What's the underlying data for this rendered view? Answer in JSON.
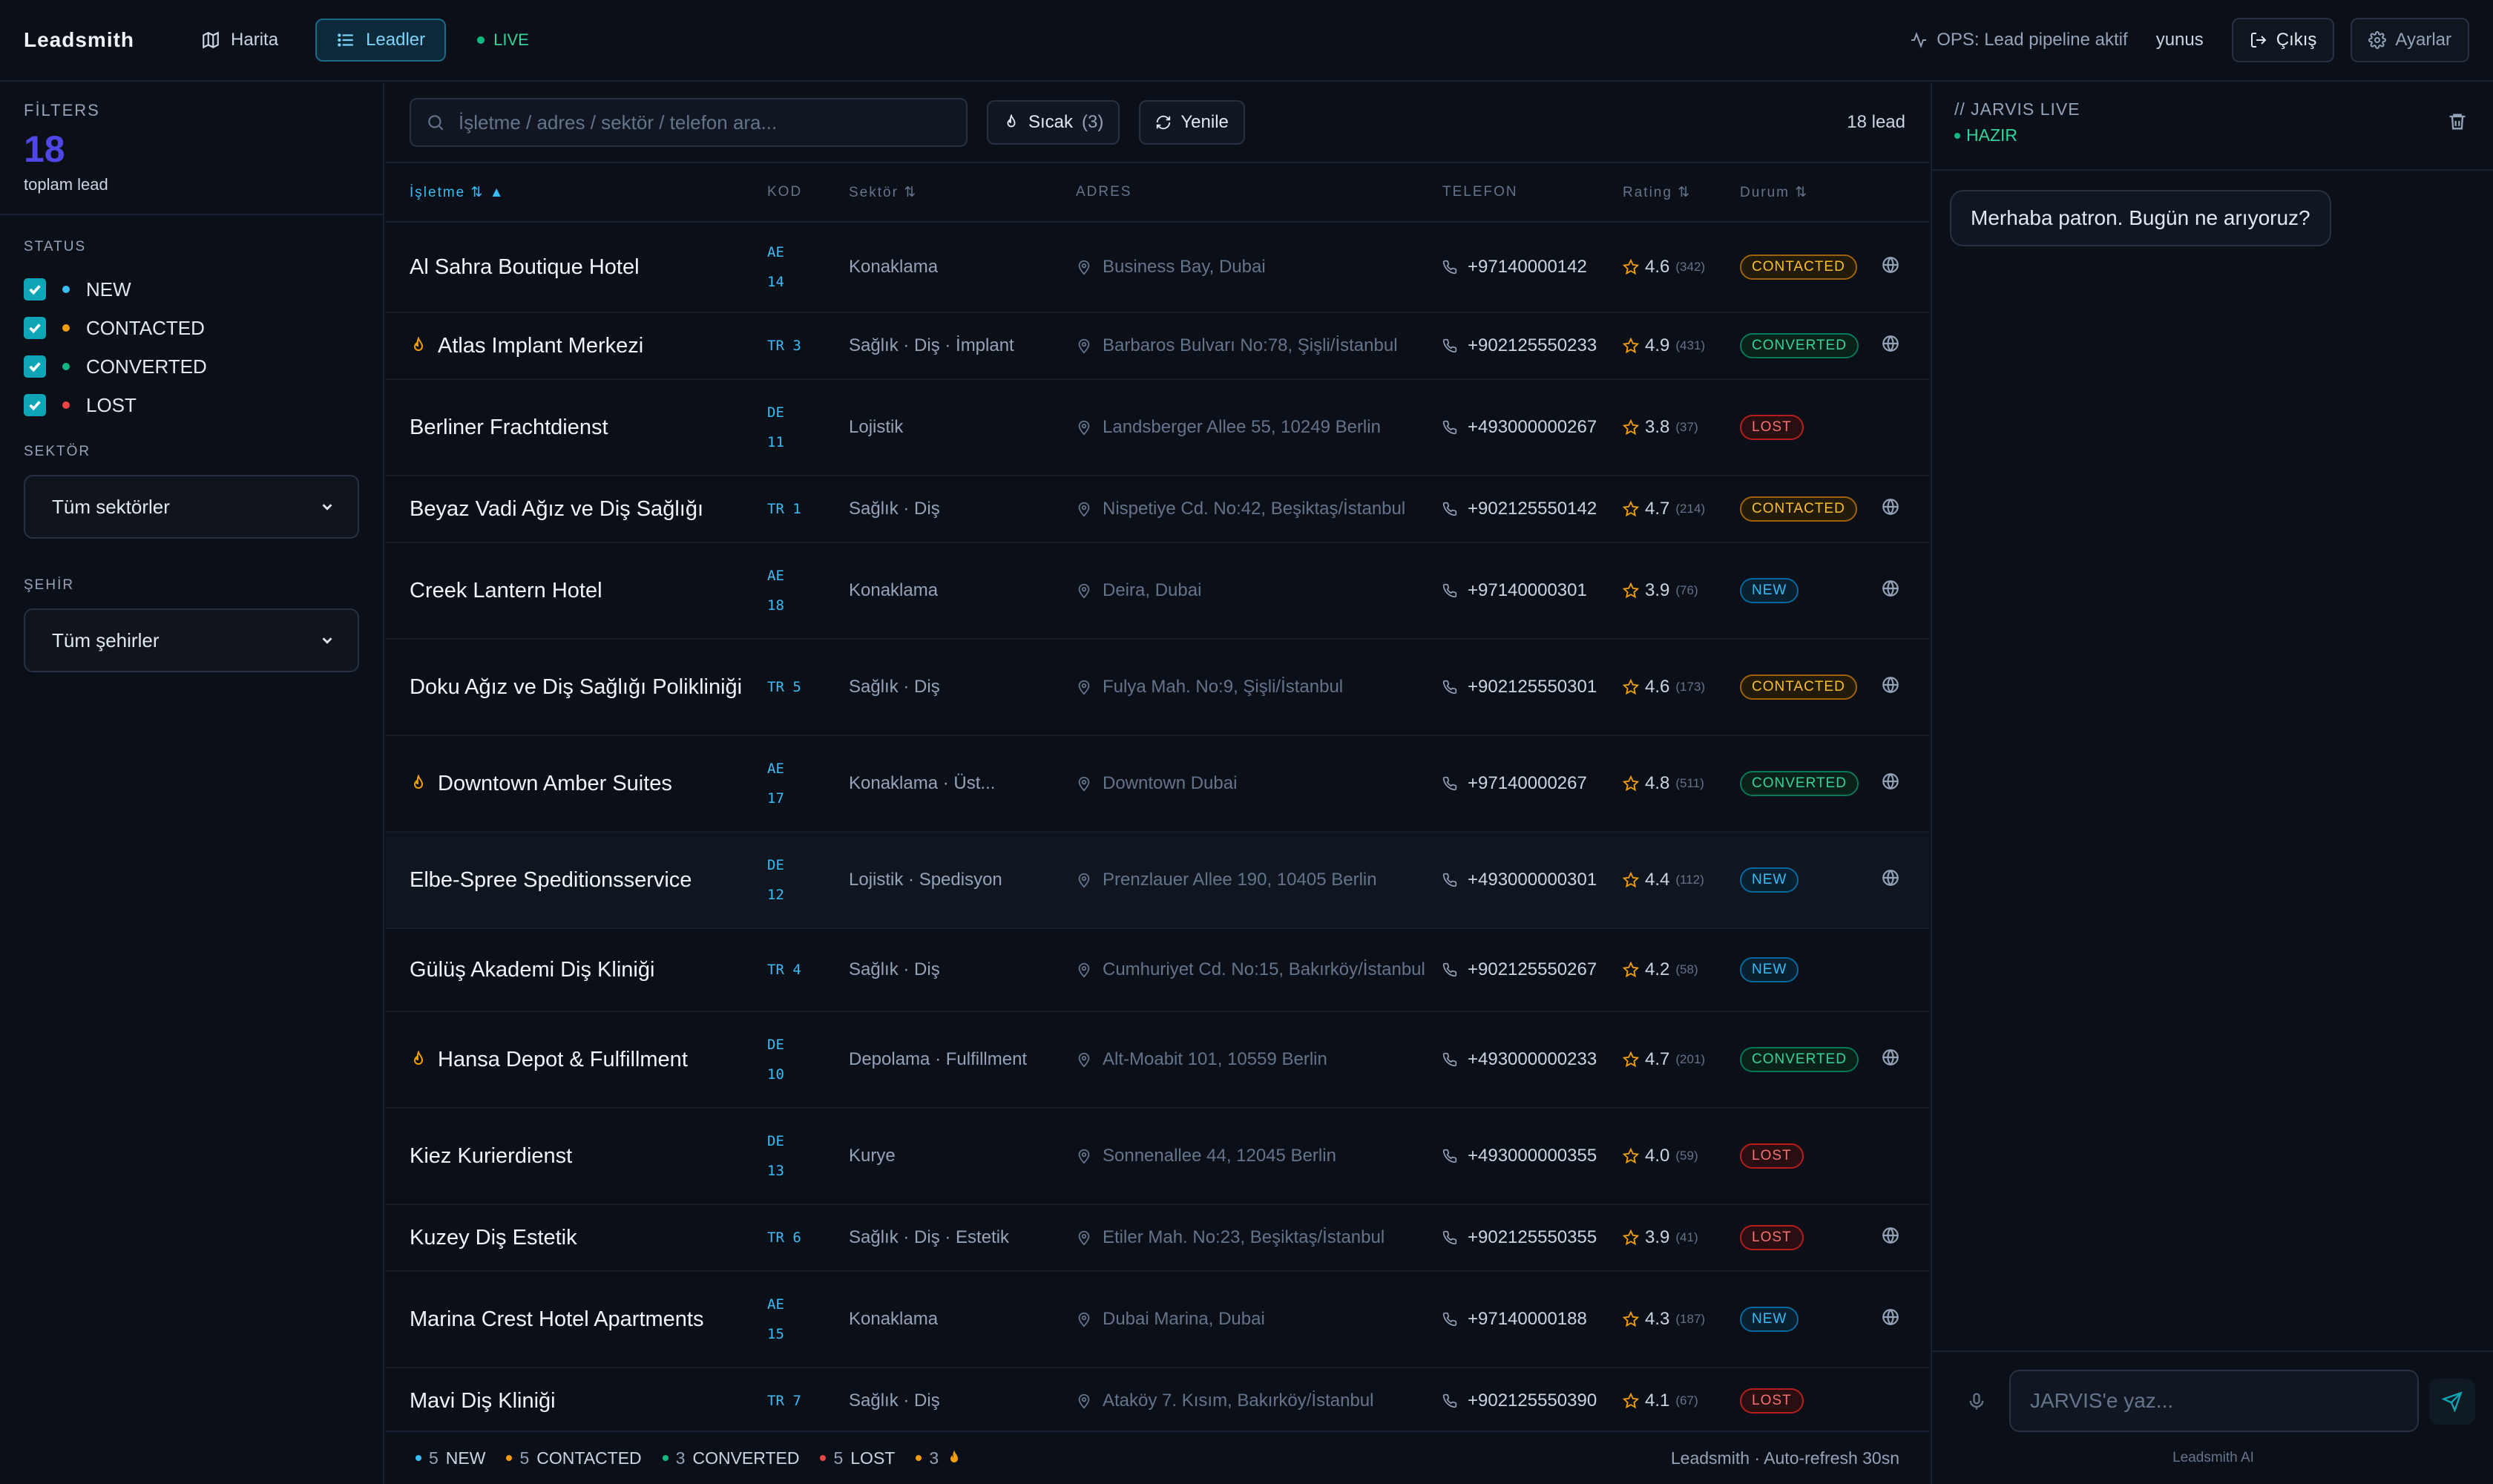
{
  "app": {
    "brand": "Leadsmith"
  },
  "nav": {
    "map": "Harita",
    "leads": "Leadler",
    "live": "LIVE"
  },
  "top": {
    "ops": "OPS: Lead pipeline aktif",
    "user": "yunus",
    "logout": "Çıkış",
    "settings": "Ayarlar"
  },
  "sidebar": {
    "filters_label": "FİLTERS",
    "total": "18",
    "total_caption": "toplam lead",
    "status_label": "STATUS",
    "statuses": [
      {
        "label": "NEW",
        "color": "#38bdf8"
      },
      {
        "label": "CONTACTED",
        "color": "#f59e0b"
      },
      {
        "label": "CONVERTED",
        "color": "#10b981"
      },
      {
        "label": "LOST",
        "color": "#ef4444"
      }
    ],
    "sector_label": "SEKTÖR",
    "sector_value": "Tüm sektörler",
    "city_label": "ŞEHİR",
    "city_value": "Tüm şehirler"
  },
  "toolbar": {
    "search_placeholder": "İşletme / adres / sektör / telefon ara...",
    "hot_label": "Sıcak",
    "hot_count": "(3)",
    "refresh_label": "Yenile",
    "lead_count": "18 lead"
  },
  "table": {
    "headers": {
      "name": "İşletme",
      "kod": "KOD",
      "sector": "Sektör",
      "address": "ADRES",
      "phone": "TELEFON",
      "rating": "Rating",
      "status": "Durum"
    },
    "rows": [
      {
        "name": "Al Sahra Boutique Hotel",
        "kod1": "AE",
        "kod2": "14",
        "sector": "Konaklama",
        "address": "Business Bay, Dubai",
        "phone": "+97140000142",
        "rating": "4.6",
        "count": "(342)",
        "status": "CONTACTED",
        "hot": false,
        "web": true
      },
      {
        "name": "Atlas Implant Merkezi",
        "kod1": "TR 3",
        "kod2": "",
        "sector": "Sağlık · Diş · İmplant",
        "address": "Barbaros Bulvarı No:78, Şişli/İstanbul",
        "phone": "+902125550233",
        "rating": "4.9",
        "count": "(431)",
        "status": "CONVERTED",
        "hot": true,
        "web": true
      },
      {
        "name": "Berliner Frachtdienst",
        "kod1": "DE",
        "kod2": "11",
        "sector": "Lojistik",
        "address": "Landsberger Allee 55, 10249 Berlin",
        "phone": "+493000000267",
        "rating": "3.8",
        "count": "(37)",
        "status": "LOST",
        "hot": false,
        "web": false
      },
      {
        "name": "Beyaz Vadi Ağız ve Diş Sağlığı",
        "kod1": "TR 1",
        "kod2": "",
        "sector": "Sağlık · Diş",
        "address": "Nispetiye Cd. No:42, Beşiktaş/İstanbul",
        "phone": "+902125550142",
        "rating": "4.7",
        "count": "(214)",
        "status": "CONTACTED",
        "hot": false,
        "web": true
      },
      {
        "name": "Creek Lantern Hotel",
        "kod1": "AE",
        "kod2": "18",
        "sector": "Konaklama",
        "address": "Deira, Dubai",
        "phone": "+97140000301",
        "rating": "3.9",
        "count": "(76)",
        "status": "NEW",
        "hot": false,
        "web": true
      },
      {
        "name": "Doku Ağız ve Diş Sağlığı Polikliniği",
        "kod1": "TR 5",
        "kod2": "",
        "sector": "Sağlık · Diş",
        "address": "Fulya Mah. No:9, Şişli/İstanbul",
        "phone": "+902125550301",
        "rating": "4.6",
        "count": "(173)",
        "status": "CONTACTED",
        "hot": false,
        "web": true
      },
      {
        "name": "Downtown Amber Suites",
        "kod1": "AE",
        "kod2": "17",
        "sector": "Konaklama · Üst...",
        "address": "Downtown Dubai",
        "phone": "+97140000267",
        "rating": "4.8",
        "count": "(511)",
        "status": "CONVERTED",
        "hot": true,
        "web": true
      },
      {
        "name": "Elbe-Spree Speditionsservice",
        "kod1": "DE",
        "kod2": "12",
        "sector": "Lojistik · Spedisyon",
        "address": "Prenzlauer Allee 190, 10405 Berlin",
        "phone": "+493000000301",
        "rating": "4.4",
        "count": "(112)",
        "status": "NEW",
        "hot": false,
        "web": true
      },
      {
        "name": "Gülüş Akademi Diş Kliniği",
        "kod1": "TR 4",
        "kod2": "",
        "sector": "Sağlık · Diş",
        "address": "Cumhuriyet Cd. No:15, Bakırköy/İstanbul",
        "phone": "+902125550267",
        "rating": "4.2",
        "count": "(58)",
        "status": "NEW",
        "hot": false,
        "web": false
      },
      {
        "name": "Hansa Depot & Fulfillment",
        "kod1": "DE",
        "kod2": "10",
        "sector": "Depolama · Fulfillment",
        "address": "Alt-Moabit 101, 10559 Berlin",
        "phone": "+493000000233",
        "rating": "4.7",
        "count": "(201)",
        "status": "CONVERTED",
        "hot": true,
        "web": true
      },
      {
        "name": "Kiez Kurierdienst",
        "kod1": "DE",
        "kod2": "13",
        "sector": "Kurye",
        "address": "Sonnenallee 44, 12045 Berlin",
        "phone": "+493000000355",
        "rating": "4.0",
        "count": "(59)",
        "status": "LOST",
        "hot": false,
        "web": false
      },
      {
        "name": "Kuzey Diş Estetik",
        "kod1": "TR 6",
        "kod2": "",
        "sector": "Sağlık · Diş · Estetik",
        "address": "Etiler Mah. No:23, Beşiktaş/İstanbul",
        "phone": "+902125550355",
        "rating": "3.9",
        "count": "(41)",
        "status": "LOST",
        "hot": false,
        "web": true
      },
      {
        "name": "Marina Crest Hotel Apartments",
        "kod1": "AE",
        "kod2": "15",
        "sector": "Konaklama",
        "address": "Dubai Marina, Dubai",
        "phone": "+97140000188",
        "rating": "4.3",
        "count": "(187)",
        "status": "NEW",
        "hot": false,
        "web": true
      },
      {
        "name": "Mavi Diş Kliniği",
        "kod1": "TR 7",
        "kod2": "",
        "sector": "Sağlık · Diş",
        "address": "Ataköy 7. Kısım, Bakırköy/İstanbul",
        "phone": "+902125550390",
        "rating": "4.1",
        "count": "(67)",
        "status": "LOST",
        "hot": false,
        "web": false
      }
    ]
  },
  "footer": {
    "items": [
      {
        "num": "5",
        "label": "NEW",
        "color": "#38bdf8"
      },
      {
        "num": "5",
        "label": "CONTACTED",
        "color": "#f59e0b"
      },
      {
        "num": "3",
        "label": "CONVERTED",
        "color": "#10b981"
      },
      {
        "num": "5",
        "label": "LOST",
        "color": "#ef4444"
      },
      {
        "num": "3",
        "label": "",
        "color": "#f59e0b"
      }
    ],
    "credit": "Leadsmith · Auto-refresh 30sn"
  },
  "jarvis": {
    "title": "// JARVIS LIVE",
    "status": "HAZIR",
    "message": "Merhaba patron. Bugün ne arıyoruz?",
    "input_placeholder": "JARVIS'e yaz...",
    "credit": "Leadsmith AI"
  }
}
